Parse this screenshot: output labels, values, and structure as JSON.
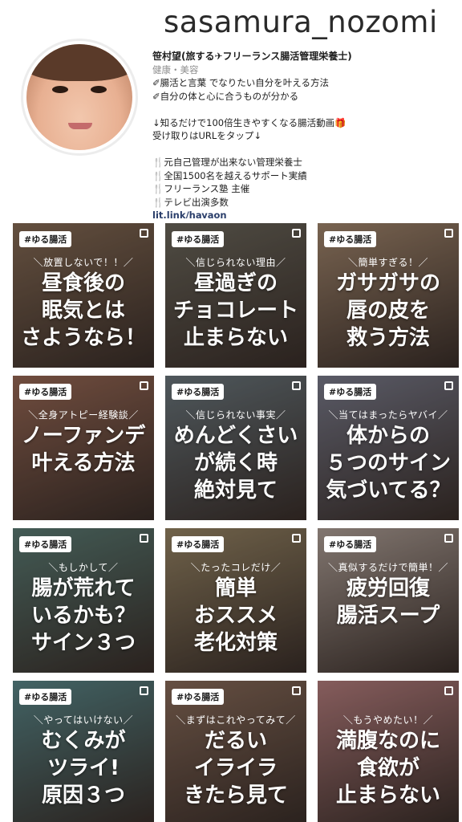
{
  "profile": {
    "username": "sasamura_nozomi",
    "display_name": "笹村望(旅する✈フリーランス腸活管理栄養士)",
    "category": "健康・美容",
    "bio_lines_1": [
      "✐腸活と言葉 でなりたい自分を叶える方法",
      "✐自分の体と心に合うものが分かる"
    ],
    "bio_lines_2": [
      "↓知るだけで100倍生きやすくなる腸活動画🎁",
      "受け取りはURLをタップ↓"
    ],
    "bio_lines_3": [
      "🍴元自己管理が出来ない管理栄養士",
      "🍴全国1500名を越えるサポート実績",
      "🍴フリーランス塾 主催",
      "🍴テレビ出演多数"
    ],
    "link": "lit.link/hayaon"
  },
  "posts": [
    {
      "tag": "#ゆる腸活",
      "sub": "＼放置しないで！！／",
      "main": "昼食後の\n眠気とは\nさようなら！",
      "bg": "#8a6e57"
    },
    {
      "tag": "#ゆる腸活",
      "sub": "＼信じられない理由／",
      "main": "昼過ぎの\nチョコレート\n止まらない",
      "bg": "#6f6a5e"
    },
    {
      "tag": "#ゆる腸活",
      "sub": "＼簡単すぎる！／",
      "main": "ガサガサの\n唇の皮を\n救う方法",
      "bg": "#a78a70"
    },
    {
      "tag": "#ゆる腸活",
      "sub": "＼全身アトピー経験談／",
      "main": "ノーファンデ\n叶える方法",
      "bg": "#9c6b57"
    },
    {
      "tag": "#ゆる腸活",
      "sub": "＼信じられない事実／",
      "main": "めんどくさい\nが続く時\n絶対見て",
      "bg": "#6e7a80"
    },
    {
      "tag": "#ゆる腸活",
      "sub": "＼当てはまったらヤバイ／",
      "main": "体からの\n５つのサイン\n気づいてる？",
      "bg": "#7d7e8e"
    },
    {
      "tag": "#ゆる腸活",
      "sub": "＼もしかして／",
      "main": "腸が荒れて\nいるかも？\nサイン３つ",
      "bg": "#5e7f77"
    },
    {
      "tag": "#ゆる腸活",
      "sub": "＼たったコレだけ／",
      "main": "簡単\nおススメ\n老化対策",
      "bg": "#9b8867"
    },
    {
      "tag": "#ゆる腸活",
      "sub": "＼真似するだけで簡単！／",
      "main": "疲労回復\n腸活スープ",
      "bg": "#b4a49b"
    },
    {
      "tag": "#ゆる腸活",
      "sub": "＼やってはいけない／",
      "main": "むくみが\nツライ!\n原因３つ",
      "bg": "#5c8a8c"
    },
    {
      "tag": "#ゆる腸活",
      "sub": "＼まずはこれやってみて／",
      "main": "だるい\nイライラ\nきたら見て",
      "bg": "#8d6e5c"
    },
    {
      "tag": "",
      "sub": "＼もうやめたい！／",
      "main": "満腹なのに\n食欲が\n止まらない",
      "bg": "#b98080"
    }
  ]
}
